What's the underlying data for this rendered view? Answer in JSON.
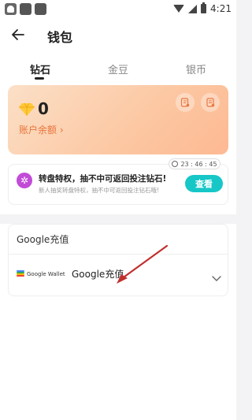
{
  "status_bar": {
    "time": "4:21"
  },
  "header": {
    "title": "钱包"
  },
  "tabs": [
    {
      "label": "钻石",
      "active": true
    },
    {
      "label": "金豆",
      "active": false
    },
    {
      "label": "银币",
      "active": false
    }
  ],
  "balance": {
    "amount": "0",
    "label": "账户余额 ›"
  },
  "promo": {
    "timer": "23 : 46 : 45",
    "title": "转盘特权，抽不中可返回投注钻石!",
    "subtitle": "新人抽奖转盘特权，抽不中可返回投注钻石哦!",
    "button_label": "查看"
  },
  "recharge": {
    "section_title": "Google充值",
    "wallet_brand": "Google Wallet",
    "option_label": "Google充值"
  },
  "colors": {
    "accent_teal": "#17c7c7",
    "balance_label": "#e8743a",
    "annotation_arrow": "#c0302e"
  }
}
